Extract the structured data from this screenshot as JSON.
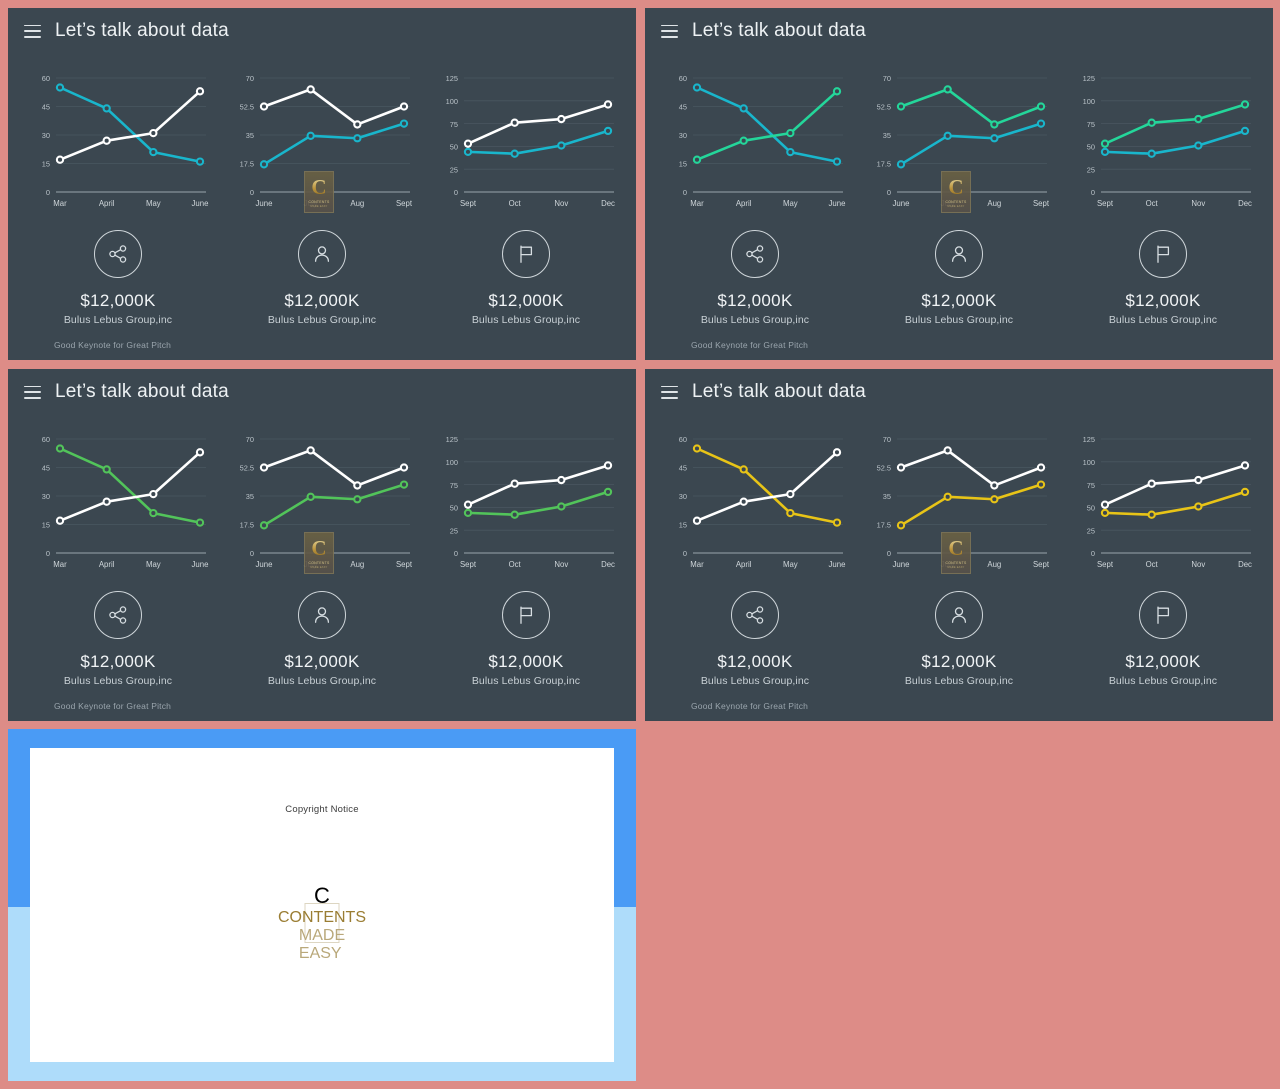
{
  "deck": {
    "background_color": "#dd8c87",
    "slide_background": "#3b4750"
  },
  "slides": [
    {
      "id": "slide-cyan",
      "menu_icon": "hamburger-menu-icon",
      "title": "Let’s talk about data",
      "footer": "Good Keynote for Great Pitch",
      "accent_color": "#19b6cc",
      "secondary_color": "#ffffff",
      "kpis": [
        {
          "icon": "share-icon",
          "value": "$12,000K",
          "label": "Bulus Lebus Group,inc"
        },
        {
          "icon": "person-icon",
          "value": "$12,000K",
          "label": "Bulus Lebus Group,inc"
        },
        {
          "icon": "flag-icon",
          "value": "$12,000K",
          "label": "Bulus Lebus Group,inc"
        }
      ]
    },
    {
      "id": "slide-cyan-green",
      "menu_icon": "hamburger-menu-icon",
      "title": "Let’s talk about data",
      "footer": "Good Keynote for Great Pitch",
      "accent_color": "#19b6cc",
      "secondary_color": "#24d69a",
      "kpis": [
        {
          "icon": "share-icon",
          "value": "$12,000K",
          "label": "Bulus Lebus Group,inc"
        },
        {
          "icon": "person-icon",
          "value": "$12,000K",
          "label": "Bulus Lebus Group,inc"
        },
        {
          "icon": "flag-icon",
          "value": "$12,000K",
          "label": "Bulus Lebus Group,inc"
        }
      ]
    },
    {
      "id": "slide-green",
      "menu_icon": "hamburger-menu-icon",
      "title": "Let’s talk about data",
      "footer": "Good Keynote for Great Pitch",
      "accent_color": "#52c45a",
      "secondary_color": "#ffffff",
      "kpis": [
        {
          "icon": "share-icon",
          "value": "$12,000K",
          "label": "Bulus Lebus Group,inc"
        },
        {
          "icon": "person-icon",
          "value": "$12,000K",
          "label": "Bulus Lebus Group,inc"
        },
        {
          "icon": "flag-icon",
          "value": "$12,000K",
          "label": "Bulus Lebus Group,inc"
        }
      ]
    },
    {
      "id": "slide-yellow",
      "menu_icon": "hamburger-menu-icon",
      "title": "Let’s talk about data",
      "footer": "Good Keynote for Great Pitch",
      "accent_color": "#e8c417",
      "secondary_color": "#ffffff",
      "kpis": [
        {
          "icon": "share-icon",
          "value": "$12,000K",
          "label": "Bulus Lebus Group,inc"
        },
        {
          "icon": "person-icon",
          "value": "$12,000K",
          "label": "Bulus Lebus Group,inc"
        },
        {
          "icon": "flag-icon",
          "value": "$12,000K",
          "label": "Bulus Lebus Group,inc"
        }
      ]
    }
  ],
  "watermark": {
    "letter": "C",
    "line1": "CONTENTS",
    "line2": "MADE  EASY"
  },
  "copyright_slide": {
    "title": "Copyright Notice",
    "logo_letter": "C",
    "logo_line1": "CONTENTS",
    "logo_line2": "MADE  EASY",
    "band_top_color": "#4a9bf5",
    "band_bottom_color": "#aedcfa",
    "paper_color": "#ffffff"
  },
  "chart_data": [
    {
      "type": "line",
      "title": "",
      "xlabel": "",
      "ylabel": "",
      "categories": [
        "Mar",
        "April",
        "May",
        "June"
      ],
      "yticks": [
        0,
        15,
        30,
        45,
        60
      ],
      "ylim": [
        0,
        60
      ],
      "grid": true,
      "legend": "none",
      "series": [
        {
          "name": "accent",
          "color": "#19b6cc",
          "values": [
            55,
            44,
            21,
            16
          ]
        },
        {
          "name": "secondary",
          "color": "#ffffff",
          "values": [
            17,
            27,
            31,
            53
          ]
        }
      ]
    },
    {
      "type": "line",
      "title": "",
      "xlabel": "",
      "ylabel": "",
      "categories": [
        "June",
        "July",
        "Aug",
        "Sept"
      ],
      "yticks": [
        0,
        17.5,
        35,
        52.5,
        70
      ],
      "ylim": [
        0,
        70
      ],
      "grid": true,
      "legend": "none",
      "series": [
        {
          "name": "accent",
          "color": "#19b6cc",
          "values": [
            17,
            34.5,
            33,
            42
          ]
        },
        {
          "name": "secondary",
          "color": "#ffffff",
          "values": [
            52.5,
            63,
            41.5,
            52.5
          ]
        }
      ]
    },
    {
      "type": "line",
      "title": "",
      "xlabel": "",
      "ylabel": "",
      "categories": [
        "Sept",
        "Oct",
        "Nov",
        "Dec"
      ],
      "yticks": [
        0,
        25,
        50,
        75,
        100,
        125
      ],
      "ylim": [
        0,
        125
      ],
      "grid": true,
      "legend": "none",
      "series": [
        {
          "name": "accent",
          "color": "#19b6cc",
          "values": [
            44,
            42,
            51,
            67
          ]
        },
        {
          "name": "secondary",
          "color": "#ffffff",
          "values": [
            53,
            76,
            80,
            96
          ]
        }
      ]
    }
  ]
}
